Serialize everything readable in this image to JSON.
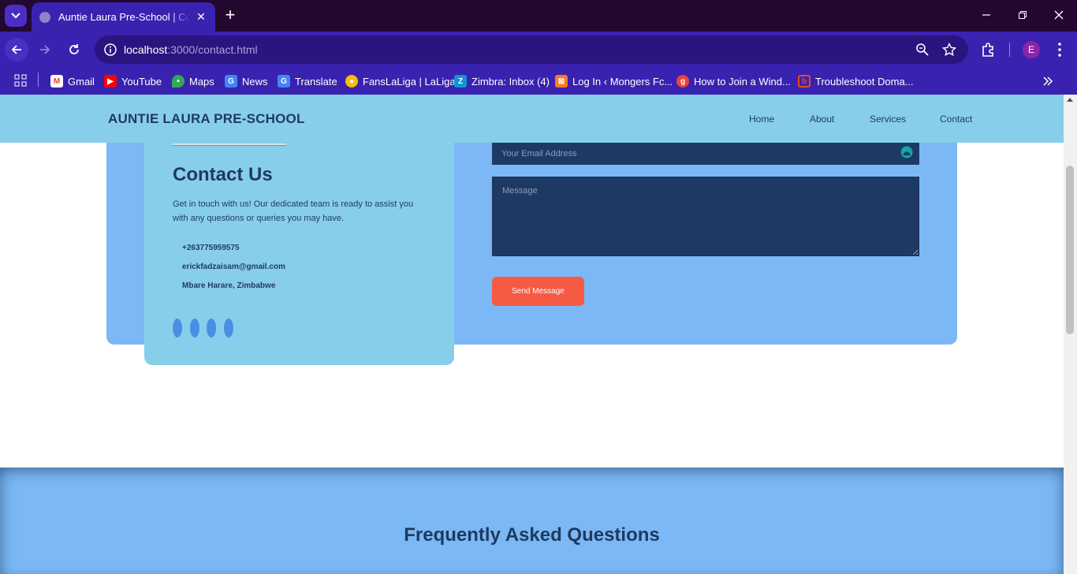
{
  "browser": {
    "tab_title": "Auntie Laura Pre-School | Contact",
    "url_host": "localhost",
    "url_rest": ":3000/contact.html",
    "profile_initial": "E",
    "bookmarks": [
      {
        "label": "Gmail",
        "icon": "gmail-icon",
        "color": "#ea4335"
      },
      {
        "label": "YouTube",
        "icon": "youtube-icon",
        "color": "#ff0000"
      },
      {
        "label": "Maps",
        "icon": "maps-icon",
        "color": "#34a853"
      },
      {
        "label": "News",
        "icon": "news-icon",
        "color": "#4285f4"
      },
      {
        "label": "Translate",
        "icon": "translate-icon",
        "color": "#4285f4"
      },
      {
        "label": "FansLaLiga | LaLiga",
        "icon": "chrome-icon",
        "color": "#fbbc05"
      },
      {
        "label": "Zimbra: Inbox (4)",
        "icon": "zimbra-icon",
        "color": "#0f95d3"
      },
      {
        "label": "Log In ‹ Mongers Fc...",
        "icon": "xampp-icon",
        "color": "#fb7a24"
      },
      {
        "label": "How to Join a Wind...",
        "icon": "g-icon",
        "color": "#e8453c"
      },
      {
        "label": "Troubleshoot Doma...",
        "icon": "doc-icon",
        "color": "#e64a19"
      }
    ]
  },
  "site": {
    "brand": "AUNTIE LAURA PRE-SCHOOL",
    "nav": [
      "Home",
      "About",
      "Services",
      "Contact"
    ]
  },
  "contact": {
    "title": "Contact Us",
    "description": "Get in touch with us! Our dedicated team is ready to assist you with any questions or queries you may have.",
    "phone": "+263775959575",
    "email": "erickfadzaisam@gmail.com",
    "address": "Mbare Harare, Zimbabwe",
    "form": {
      "email_placeholder": "Your Email Address",
      "message_placeholder": "Message",
      "submit_label": "Send Message"
    }
  },
  "faq": {
    "title": "Frequently Asked Questions"
  },
  "colors": {
    "header_bg": "#87ceeb",
    "section_bg": "#7bb8f5",
    "field_bg": "#1e3a64",
    "button_bg": "#f55a42",
    "text_dark": "#1e3a5f"
  }
}
